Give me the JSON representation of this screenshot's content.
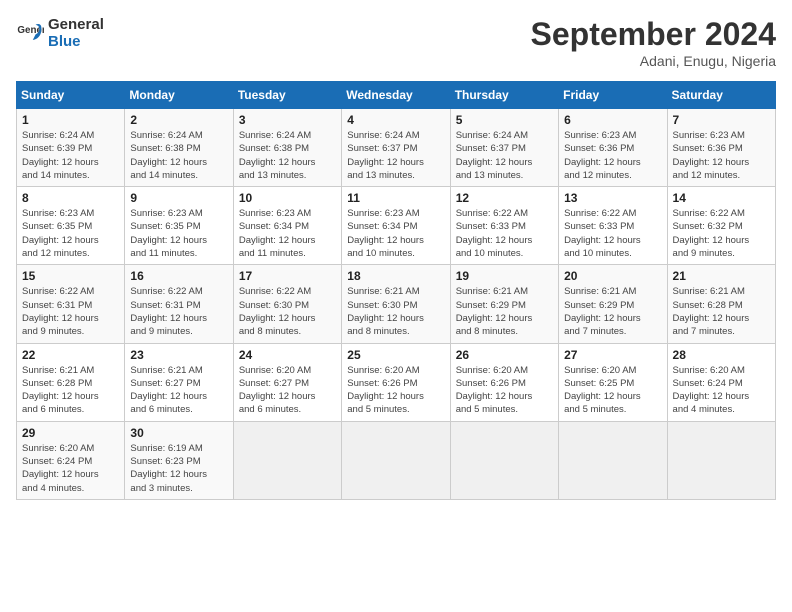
{
  "header": {
    "logo_general": "General",
    "logo_blue": "Blue",
    "month_title": "September 2024",
    "location": "Adani, Enugu, Nigeria"
  },
  "columns": [
    "Sunday",
    "Monday",
    "Tuesday",
    "Wednesday",
    "Thursday",
    "Friday",
    "Saturday"
  ],
  "weeks": [
    [
      {
        "day": "1",
        "sunrise": "Sunrise: 6:24 AM",
        "sunset": "Sunset: 6:39 PM",
        "daylight": "Daylight: 12 hours and 14 minutes."
      },
      {
        "day": "2",
        "sunrise": "Sunrise: 6:24 AM",
        "sunset": "Sunset: 6:38 PM",
        "daylight": "Daylight: 12 hours and 14 minutes."
      },
      {
        "day": "3",
        "sunrise": "Sunrise: 6:24 AM",
        "sunset": "Sunset: 6:38 PM",
        "daylight": "Daylight: 12 hours and 13 minutes."
      },
      {
        "day": "4",
        "sunrise": "Sunrise: 6:24 AM",
        "sunset": "Sunset: 6:37 PM",
        "daylight": "Daylight: 12 hours and 13 minutes."
      },
      {
        "day": "5",
        "sunrise": "Sunrise: 6:24 AM",
        "sunset": "Sunset: 6:37 PM",
        "daylight": "Daylight: 12 hours and 13 minutes."
      },
      {
        "day": "6",
        "sunrise": "Sunrise: 6:23 AM",
        "sunset": "Sunset: 6:36 PM",
        "daylight": "Daylight: 12 hours and 12 minutes."
      },
      {
        "day": "7",
        "sunrise": "Sunrise: 6:23 AM",
        "sunset": "Sunset: 6:36 PM",
        "daylight": "Daylight: 12 hours and 12 minutes."
      }
    ],
    [
      {
        "day": "8",
        "sunrise": "Sunrise: 6:23 AM",
        "sunset": "Sunset: 6:35 PM",
        "daylight": "Daylight: 12 hours and 12 minutes."
      },
      {
        "day": "9",
        "sunrise": "Sunrise: 6:23 AM",
        "sunset": "Sunset: 6:35 PM",
        "daylight": "Daylight: 12 hours and 11 minutes."
      },
      {
        "day": "10",
        "sunrise": "Sunrise: 6:23 AM",
        "sunset": "Sunset: 6:34 PM",
        "daylight": "Daylight: 12 hours and 11 minutes."
      },
      {
        "day": "11",
        "sunrise": "Sunrise: 6:23 AM",
        "sunset": "Sunset: 6:34 PM",
        "daylight": "Daylight: 12 hours and 10 minutes."
      },
      {
        "day": "12",
        "sunrise": "Sunrise: 6:22 AM",
        "sunset": "Sunset: 6:33 PM",
        "daylight": "Daylight: 12 hours and 10 minutes."
      },
      {
        "day": "13",
        "sunrise": "Sunrise: 6:22 AM",
        "sunset": "Sunset: 6:33 PM",
        "daylight": "Daylight: 12 hours and 10 minutes."
      },
      {
        "day": "14",
        "sunrise": "Sunrise: 6:22 AM",
        "sunset": "Sunset: 6:32 PM",
        "daylight": "Daylight: 12 hours and 9 minutes."
      }
    ],
    [
      {
        "day": "15",
        "sunrise": "Sunrise: 6:22 AM",
        "sunset": "Sunset: 6:31 PM",
        "daylight": "Daylight: 12 hours and 9 minutes."
      },
      {
        "day": "16",
        "sunrise": "Sunrise: 6:22 AM",
        "sunset": "Sunset: 6:31 PM",
        "daylight": "Daylight: 12 hours and 9 minutes."
      },
      {
        "day": "17",
        "sunrise": "Sunrise: 6:22 AM",
        "sunset": "Sunset: 6:30 PM",
        "daylight": "Daylight: 12 hours and 8 minutes."
      },
      {
        "day": "18",
        "sunrise": "Sunrise: 6:21 AM",
        "sunset": "Sunset: 6:30 PM",
        "daylight": "Daylight: 12 hours and 8 minutes."
      },
      {
        "day": "19",
        "sunrise": "Sunrise: 6:21 AM",
        "sunset": "Sunset: 6:29 PM",
        "daylight": "Daylight: 12 hours and 8 minutes."
      },
      {
        "day": "20",
        "sunrise": "Sunrise: 6:21 AM",
        "sunset": "Sunset: 6:29 PM",
        "daylight": "Daylight: 12 hours and 7 minutes."
      },
      {
        "day": "21",
        "sunrise": "Sunrise: 6:21 AM",
        "sunset": "Sunset: 6:28 PM",
        "daylight": "Daylight: 12 hours and 7 minutes."
      }
    ],
    [
      {
        "day": "22",
        "sunrise": "Sunrise: 6:21 AM",
        "sunset": "Sunset: 6:28 PM",
        "daylight": "Daylight: 12 hours and 6 minutes."
      },
      {
        "day": "23",
        "sunrise": "Sunrise: 6:21 AM",
        "sunset": "Sunset: 6:27 PM",
        "daylight": "Daylight: 12 hours and 6 minutes."
      },
      {
        "day": "24",
        "sunrise": "Sunrise: 6:20 AM",
        "sunset": "Sunset: 6:27 PM",
        "daylight": "Daylight: 12 hours and 6 minutes."
      },
      {
        "day": "25",
        "sunrise": "Sunrise: 6:20 AM",
        "sunset": "Sunset: 6:26 PM",
        "daylight": "Daylight: 12 hours and 5 minutes."
      },
      {
        "day": "26",
        "sunrise": "Sunrise: 6:20 AM",
        "sunset": "Sunset: 6:26 PM",
        "daylight": "Daylight: 12 hours and 5 minutes."
      },
      {
        "day": "27",
        "sunrise": "Sunrise: 6:20 AM",
        "sunset": "Sunset: 6:25 PM",
        "daylight": "Daylight: 12 hours and 5 minutes."
      },
      {
        "day": "28",
        "sunrise": "Sunrise: 6:20 AM",
        "sunset": "Sunset: 6:24 PM",
        "daylight": "Daylight: 12 hours and 4 minutes."
      }
    ],
    [
      {
        "day": "29",
        "sunrise": "Sunrise: 6:20 AM",
        "sunset": "Sunset: 6:24 PM",
        "daylight": "Daylight: 12 hours and 4 minutes."
      },
      {
        "day": "30",
        "sunrise": "Sunrise: 6:19 AM",
        "sunset": "Sunset: 6:23 PM",
        "daylight": "Daylight: 12 hours and 3 minutes."
      },
      null,
      null,
      null,
      null,
      null
    ]
  ]
}
